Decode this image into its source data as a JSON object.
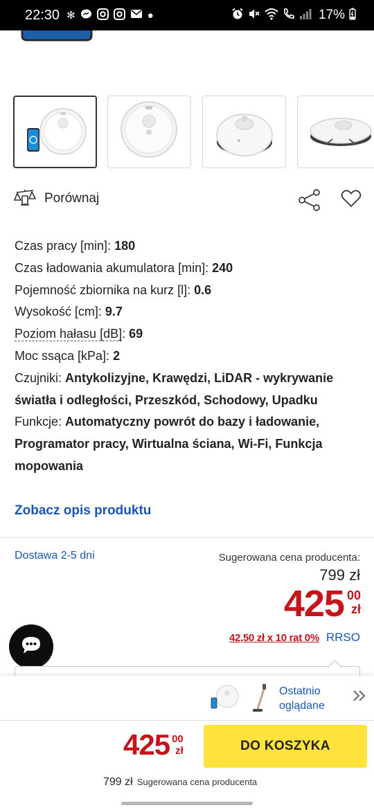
{
  "status_bar": {
    "time": "22:30",
    "battery": "17%",
    "left_icons": [
      "fan-icon",
      "messenger-icon",
      "instagram-icon",
      "instagram-icon",
      "mail-icon",
      "dot-icon"
    ],
    "right_icons": [
      "alarm-icon",
      "mute-icon",
      "wifi-icon",
      "call-icon",
      "signal-icon",
      "battery-charging-icon"
    ]
  },
  "gallery": {
    "thumbnails": [
      "robot-with-phone",
      "robot-top-view",
      "robot-angled-view",
      "robot-on-dock"
    ]
  },
  "actions": {
    "compare_label": "Porównaj",
    "share_icon": "share-icon",
    "favorite_icon": "heart-icon"
  },
  "specs": [
    {
      "label": "Czas pracy [min]:",
      "value": "180"
    },
    {
      "label": "Czas ładowania akumulatora [min]:",
      "value": "240"
    },
    {
      "label": "Pojemność zbiornika na kurz [l]:",
      "value": "0.6"
    },
    {
      "label": "Wysokość [cm]:",
      "value": "9.7"
    },
    {
      "label": "Poziom hałasu [dB]",
      "suffix": ":",
      "value": "69"
    },
    {
      "label": "Moc ssąca [kPa]:",
      "value": "2"
    },
    {
      "label": "Czujniki:",
      "value": "Antykolizyjne, Krawędzi, LiDAR - wykrywanie światła i odległości, Przeszkód, Schodowy, Upadku"
    },
    {
      "label": "Funkcje:",
      "value": "Automatyczny powrót do bazy i ładowanie, Programator pracy, Wirtualna ściana, Wi-Fi, Funkcja mopowania"
    }
  ],
  "description_link": "Zobacz opis produktu",
  "pricing": {
    "delivery": "Dostawa 2-5 dni",
    "suggested_label": "Sugerowana cena producenta:",
    "old_price": "799 zł",
    "price_main": "425",
    "price_cents": "00",
    "currency": "zł",
    "installment": "42,50 zł x 10 rat 0%",
    "rrso": "RRSO"
  },
  "recently_viewed": {
    "label": "Ostatnio oglądane"
  },
  "bottom_bar": {
    "price_main": "425",
    "price_cents": "00",
    "currency": "zł",
    "cart_button": "DO KOSZYKA",
    "old_price": "799 zł",
    "suggested_label": "Sugerowana cena producenta"
  },
  "colors": {
    "accent_blue": "#1a56b7",
    "price_red": "#c4141c",
    "cart_yellow": "#ffe23b"
  }
}
